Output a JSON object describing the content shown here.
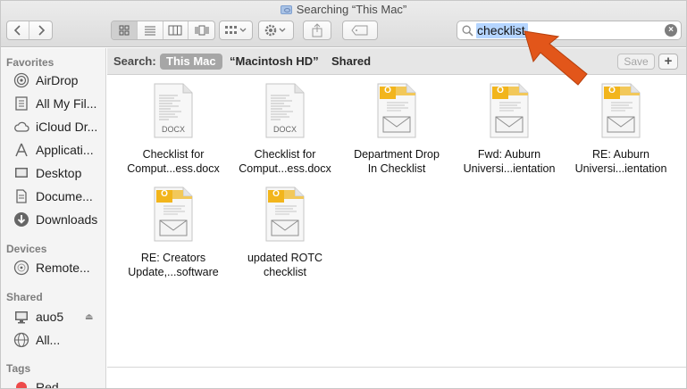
{
  "window": {
    "title": "Searching “This Mac”"
  },
  "toolbar": {
    "back_icon": "chevron-left-icon",
    "forward_icon": "chevron-right-icon",
    "view_modes": [
      "icon-view-icon",
      "list-view-icon",
      "column-view-icon",
      "cover-flow-icon"
    ],
    "arrange_icon": "arrange-grid-icon",
    "action_icon": "gear-icon",
    "share_icon": "share-icon",
    "tag_icon": "tag-icon"
  },
  "search": {
    "value": "checklist",
    "icon": "magnifier-icon",
    "clear_icon": "clear-icon"
  },
  "scope": {
    "label": "Search:",
    "options": [
      "This Mac",
      "“Macintosh HD”",
      "Shared"
    ],
    "selected": "This Mac",
    "save_label": "Save",
    "add_label": "+"
  },
  "sidebar": {
    "favorites_header": "Favorites",
    "favorites": [
      {
        "label": "AirDrop",
        "icon": "airdrop-icon"
      },
      {
        "label": "All My Fil...",
        "icon": "all-files-icon"
      },
      {
        "label": "iCloud Dr...",
        "icon": "cloud-icon"
      },
      {
        "label": "Applicati...",
        "icon": "applications-icon"
      },
      {
        "label": "Desktop",
        "icon": "desktop-icon"
      },
      {
        "label": "Docume...",
        "icon": "document-icon"
      },
      {
        "label": "Downloads",
        "icon": "download-icon"
      }
    ],
    "devices_header": "Devices",
    "devices": [
      {
        "label": "Remote...",
        "icon": "disc-icon"
      }
    ],
    "shared_header": "Shared",
    "shared": [
      {
        "label": "auo5",
        "icon": "monitor-icon"
      },
      {
        "label": "All...",
        "icon": "network-globe-icon"
      }
    ],
    "tags_header": "Tags",
    "tags": [
      {
        "label": "Red",
        "color": "#ee4b4b"
      }
    ]
  },
  "files": [
    {
      "name_line1": "Checklist for",
      "name_line2": "Comput...ess.docx",
      "kind": "docx",
      "badge": "DOCX"
    },
    {
      "name_line1": "Checklist for",
      "name_line2": "Comput...ess.docx",
      "kind": "docx",
      "badge": "DOCX"
    },
    {
      "name_line1": "Department Drop",
      "name_line2": "In Checklist",
      "kind": "email",
      "badge": "O"
    },
    {
      "name_line1": "Fwd: Auburn",
      "name_line2": "Universi...ientation",
      "kind": "email",
      "badge": "O"
    },
    {
      "name_line1": "RE: Auburn",
      "name_line2": "Universi...ientation",
      "kind": "email",
      "badge": "O"
    },
    {
      "name_line1": "RE: Creators",
      "name_line2": "Update,...software",
      "kind": "email",
      "badge": "O"
    },
    {
      "name_line1": "updated ROTC",
      "name_line2": "checklist",
      "kind": "email",
      "badge": "O"
    }
  ],
  "colors": {
    "accent_arrow": "#e2561a",
    "outlook_badge": "#f2b51c",
    "selection": "#b5d5ff"
  }
}
